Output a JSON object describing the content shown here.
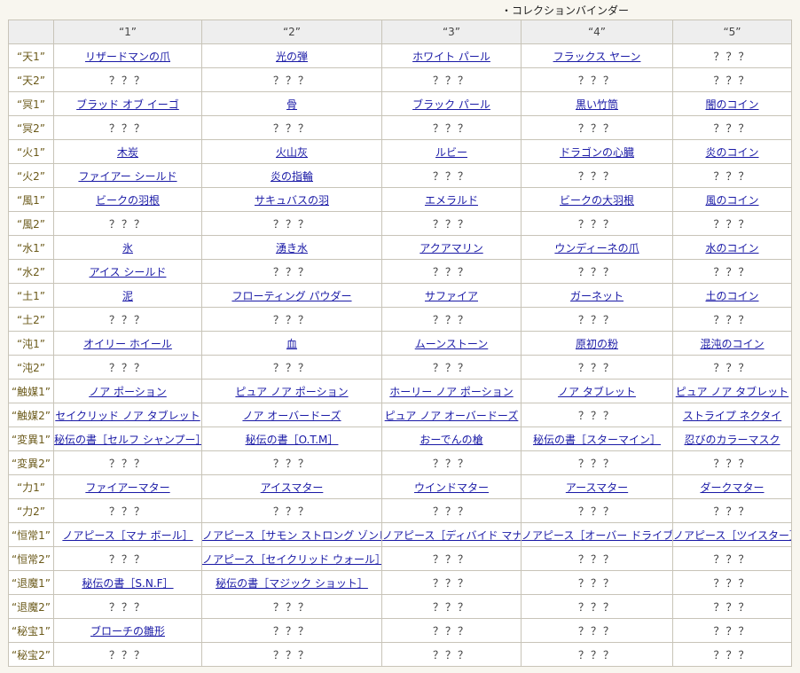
{
  "caption": "・コレクションバインダー",
  "unknown_label": "？？？",
  "columns": [
    "“1”",
    "“2”",
    "“3”",
    "“4”",
    "“5”"
  ],
  "rows": [
    {
      "label": "“天1”",
      "cells": [
        "リザードマンの爪",
        "光の弾",
        "ホワイト パール",
        "フラックス ヤーン",
        "？？？"
      ]
    },
    {
      "label": "“天2”",
      "cells": [
        "？？？",
        "？？？",
        "？？？",
        "？？？",
        "？？？"
      ]
    },
    {
      "label": "“冥1”",
      "cells": [
        "ブラッド オブ イーゴ",
        "骨",
        "ブラック パール",
        "黒い竹筒",
        "闇のコイン"
      ]
    },
    {
      "label": "“冥2”",
      "cells": [
        "？？？",
        "？？？",
        "？？？",
        "？？？",
        "？？？"
      ]
    },
    {
      "label": "“火1”",
      "cells": [
        "木炭",
        "火山灰",
        "ルビー",
        "ドラゴンの心臓",
        "炎のコイン"
      ]
    },
    {
      "label": "“火2”",
      "cells": [
        "ファイアー シールド",
        "炎の指輪",
        "？？？",
        "？？？",
        "？？？"
      ]
    },
    {
      "label": "“風1”",
      "cells": [
        "ビークの羽根",
        "サキュバスの羽",
        "エメラルド",
        "ビークの大羽根",
        "風のコイン"
      ]
    },
    {
      "label": "“風2”",
      "cells": [
        "？？？",
        "？？？",
        "？？？",
        "？？？",
        "？？？"
      ]
    },
    {
      "label": "“水1”",
      "cells": [
        "氷",
        "湧き水",
        "アクアマリン",
        "ウンディーネの爪",
        "水のコイン"
      ]
    },
    {
      "label": "“水2”",
      "cells": [
        "アイス シールド",
        "？？？",
        "？？？",
        "？？？",
        "？？？"
      ]
    },
    {
      "label": "“土1”",
      "cells": [
        "泥",
        "フローティング パウダー",
        "サファイア",
        "ガーネット",
        "土のコイン"
      ]
    },
    {
      "label": "“土2”",
      "cells": [
        "？？？",
        "？？？",
        "？？？",
        "？？？",
        "？？？"
      ]
    },
    {
      "label": "“沌1”",
      "cells": [
        "オイリー ホイール",
        "血",
        "ムーンストーン",
        "原初の粉",
        "混沌のコイン"
      ]
    },
    {
      "label": "“沌2”",
      "cells": [
        "？？？",
        "？？？",
        "？？？",
        "？？？",
        "？？？"
      ]
    },
    {
      "label": "“触媒1”",
      "cells": [
        "ノア ポーション",
        "ピュア ノア ポーション",
        "ホーリー ノア ポーション",
        "ノア タブレット",
        "ピュア ノア タブレット"
      ]
    },
    {
      "label": "“触媒2”",
      "cells": [
        "セイクリッド ノア タブレット",
        "ノア オーバードーズ",
        "ピュア ノア オーバードーズ",
        "？？？",
        "ストライプ ネクタイ"
      ]
    },
    {
      "label": "“変異1”",
      "cells": [
        "秘伝の書［セルフ シャンプー］",
        "秘伝の書［O.T.M］",
        "おーでんの槍",
        "秘伝の書［スターマイン］",
        "忍びのカラーマスク"
      ]
    },
    {
      "label": "“変異2”",
      "cells": [
        "？？？",
        "？？？",
        "？？？",
        "？？？",
        "？？？"
      ]
    },
    {
      "label": "“力1”",
      "cells": [
        "ファイアーマター",
        "アイスマター",
        "ウインドマター",
        "アースマター",
        "ダークマター"
      ]
    },
    {
      "label": "“力2”",
      "cells": [
        "？？？",
        "？？？",
        "？？？",
        "？？？",
        "？？？"
      ]
    },
    {
      "label": "“恒常1”",
      "cells": [
        "ノアピース［マナ ボール］",
        "ノアピース［サモン ストロング ゾンビ］",
        "ノアピース［ディバイド マナ］",
        "ノアピース［オーバー ドライブ］",
        "ノアピース［ツイスター］"
      ]
    },
    {
      "label": "“恒常2”",
      "cells": [
        "？？？",
        "ノアピース［セイクリッド ウォール］",
        "？？？",
        "？？？",
        "？？？"
      ]
    },
    {
      "label": "“退魔1”",
      "cells": [
        "秘伝の書［S.N.F］",
        "秘伝の書［マジック ショット］",
        "？？？",
        "？？？",
        "？？？"
      ]
    },
    {
      "label": "“退魔2”",
      "cells": [
        "？？？",
        "？？？",
        "？？？",
        "？？？",
        "？？？"
      ]
    },
    {
      "label": "“秘宝1”",
      "cells": [
        "ブローチの雛形",
        "？？？",
        "？？？",
        "？？？",
        "？？？"
      ]
    },
    {
      "label": "“秘宝2”",
      "cells": [
        "？？？",
        "？？？",
        "？？？",
        "？？？",
        "？？？"
      ]
    }
  ]
}
